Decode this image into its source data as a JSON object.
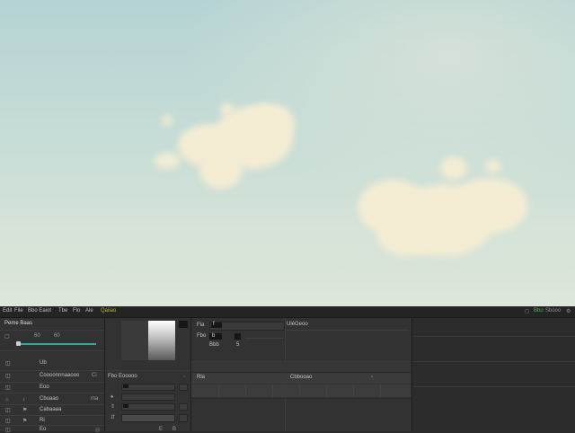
{
  "menubar": {
    "items": [
      "Edit",
      "File",
      "Bbo Eaiot",
      "Tbe",
      "Flo",
      "Ale",
      "Qaiiao"
    ],
    "status": [
      "Bbo",
      "Sbooo"
    ]
  },
  "left_panel": {
    "title": "Peme Baas",
    "slider": {
      "label": "Cb",
      "value": "60",
      "value2": "60"
    },
    "rows": [
      "Ub",
      "Coooonnnaaooo",
      "Eoo",
      "Cbuaao",
      "Cabaaaa",
      "Ri",
      "Eo"
    ],
    "badges": [
      "Ci",
      "ma"
    ]
  },
  "mid_panel": {
    "label": "Fbo Eooooo",
    "bottom_labels": [
      "E",
      "B"
    ]
  },
  "props_panel": {
    "label_a": "Fla",
    "field_a": "f",
    "link": "UléGeoo",
    "label_b": "Fbo",
    "field_b": "b",
    "label_c": "Bbb",
    "value_c": "5",
    "section_a": "Rla",
    "section_b": "Cbbooao"
  },
  "colors": {
    "sky_top": "#b5d3d4",
    "sky_bottom": "#dde6da",
    "cloud": "#f3ecd3",
    "editor_bg": "#2e2e2e",
    "accent": "#3ca3a0",
    "status_green": "#56b050"
  }
}
